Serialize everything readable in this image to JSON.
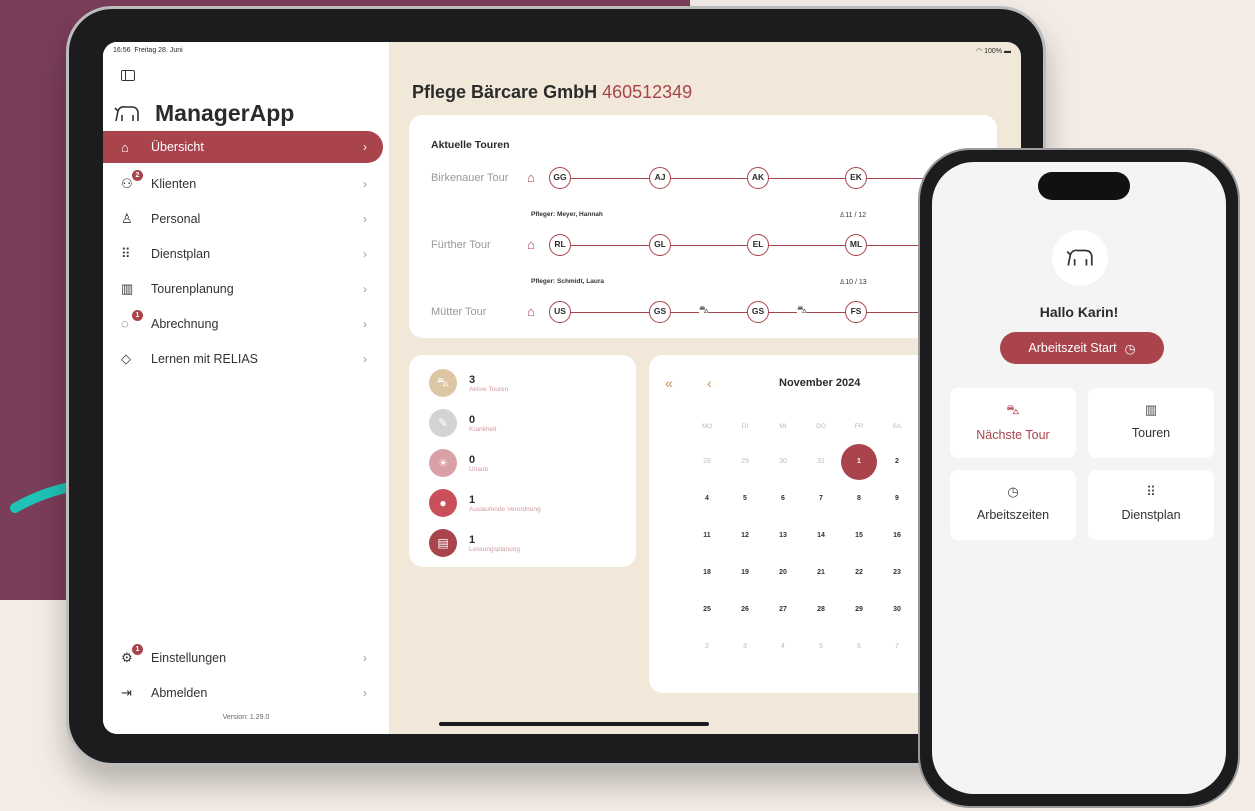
{
  "colors": {
    "accent": "#a9444c",
    "plum": "#7a3d5a",
    "arrow": "#1fc3b6",
    "cream": "#f1e8da"
  },
  "status": {
    "time": "16:56",
    "date": "Freitag 28. Juni",
    "battery": "100%"
  },
  "sidebar": {
    "app_title": "ManagerApp",
    "items": [
      {
        "label": "Übersicht",
        "icon": "home-icon",
        "badge": ""
      },
      {
        "label": "Klienten",
        "icon": "users-icon",
        "badge": "2"
      },
      {
        "label": "Personal",
        "icon": "person-icon",
        "badge": ""
      },
      {
        "label": "Dienstplan",
        "icon": "grid-icon",
        "badge": ""
      },
      {
        "label": "Tourenplanung",
        "icon": "map-icon",
        "badge": ""
      },
      {
        "label": "Abrechnung",
        "icon": "euro-icon",
        "badge": "1"
      },
      {
        "label": "Lernen mit RELIAS",
        "icon": "graduation-icon",
        "badge": ""
      }
    ],
    "bottom_items": [
      {
        "label": "Einstellungen",
        "icon": "gear-icon",
        "badge": "1"
      },
      {
        "label": "Abmelden",
        "icon": "logout-icon",
        "badge": ""
      }
    ],
    "version": "Version: 1.29.0"
  },
  "main": {
    "company": "Pflege Bärcare GmbH",
    "company_id": "460512349",
    "tours_title": "Aktuelle Touren",
    "tours": [
      {
        "name": "Birkenauer Tour",
        "nodes": [
          "GG",
          "AJ",
          "AK",
          "EK"
        ],
        "nurse": "Pfleger: Meyer, Hannah",
        "count": "11 / 12"
      },
      {
        "name": "Fürther Tour",
        "nodes": [
          "RL",
          "GL",
          "EL",
          "ML"
        ],
        "nurse": "Pfleger: Schmidt, Laura",
        "count": "10 / 13"
      },
      {
        "name": "Mütter Tour",
        "nodes": [
          "US",
          "GS",
          "GS",
          "FS"
        ],
        "nurse": "",
        "count": ""
      }
    ],
    "stats": [
      {
        "value": "3",
        "label": "Aktive Touren",
        "icon": "car-icon",
        "color": "#dcc6a3"
      },
      {
        "value": "0",
        "label": "Krankheit",
        "icon": "feather-icon",
        "color": "#d3d3d3"
      },
      {
        "value": "0",
        "label": "Urlaub",
        "icon": "sun-icon",
        "color": "#d9a0a6"
      },
      {
        "value": "1",
        "label": "Auslaufende Verordnung",
        "icon": "pill-icon",
        "color": "#c9505a"
      },
      {
        "value": "1",
        "label": "Leistungsplanung",
        "icon": "document-icon",
        "color": "#a9444c"
      }
    ],
    "calendar": {
      "month": "November 2024",
      "weekdays": [
        "MO",
        "DI",
        "MI",
        "DO",
        "FR",
        "SA"
      ],
      "weeks": [
        [
          "28",
          "29",
          "30",
          "31",
          "1",
          "2"
        ],
        [
          "4",
          "5",
          "6",
          "7",
          "8",
          "9"
        ],
        [
          "11",
          "12",
          "13",
          "14",
          "15",
          "16"
        ],
        [
          "18",
          "19",
          "20",
          "21",
          "22",
          "23"
        ],
        [
          "25",
          "26",
          "27",
          "28",
          "29",
          "30"
        ],
        [
          "2",
          "3",
          "4",
          "5",
          "6",
          "7"
        ]
      ],
      "today": "1"
    }
  },
  "phone": {
    "greeting": "Hallo Karin!",
    "start_label": "Arbeitszeit Start",
    "tiles": [
      {
        "label": "Nächste Tour",
        "icon": "car-icon"
      },
      {
        "label": "Touren",
        "icon": "map-icon"
      },
      {
        "label": "Arbeitszeiten",
        "icon": "clock-icon"
      },
      {
        "label": "Dienstplan",
        "icon": "grid-icon"
      }
    ]
  }
}
